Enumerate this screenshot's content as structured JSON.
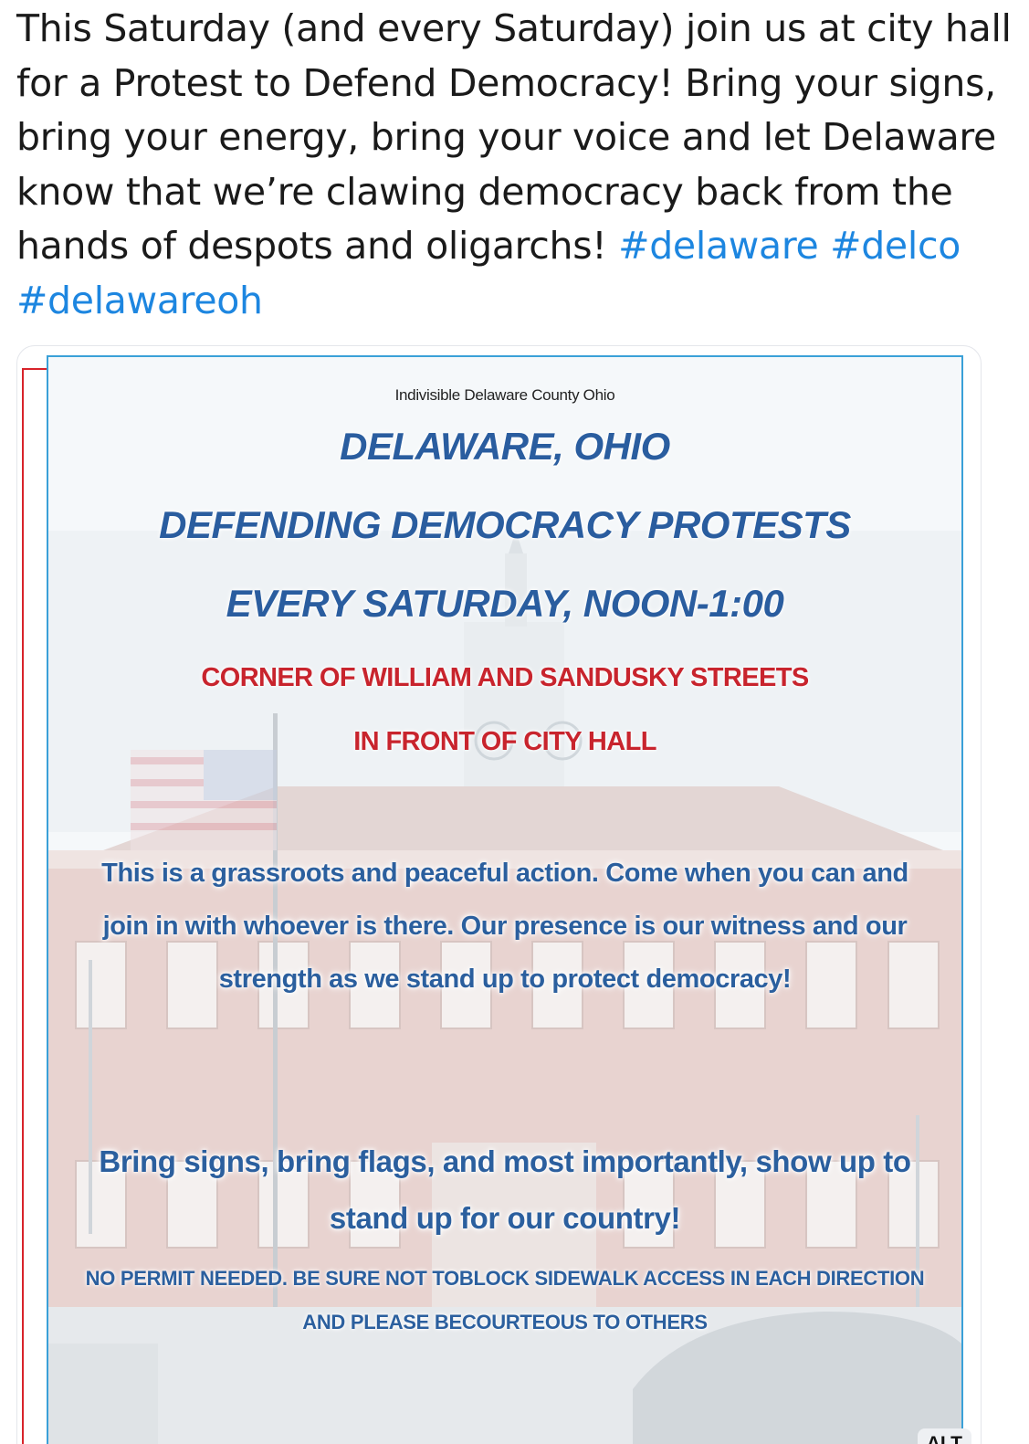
{
  "post": {
    "text_main": "This Saturday (and every Saturday) join us at city hall for a Protest to Defend Democracy! Bring your signs, bring your energy, bring your voice and let Delaware know that we’re clawing democracy back from the hands of despots and oligarchs! ",
    "hashtags": [
      "#delaware",
      "#delco",
      "#delawareoh"
    ]
  },
  "flyer": {
    "org": "Indivisible Delaware County Ohio",
    "heading1": "DELAWARE, OHIO",
    "heading2": "DEFENDING DEMOCRACY PROTESTS",
    "heading3": "EVERY SATURDAY, NOON-1:00",
    "location1": "CORNER OF WILLIAM AND SANDUSKY STREETS",
    "location2": "IN FRONT OF CITY HALL",
    "paragraph1": "This is a grassroots and peaceful action. Come when you can and join in with whoever is there. Our presence is our witness and our strength as we stand up to protect democracy!",
    "paragraph2": "Bring signs, bring flags, and most importantly, show up to stand up for our country!",
    "note": "NO PERMIT NEEDED.  BE SURE NOT TOBLOCK SIDEWALK ACCESS IN EACH DIRECTION AND PLEASE BECOURTEOUS TO OTHERS"
  },
  "media": {
    "alt_label": "ALT"
  },
  "colors": {
    "hashtag": "#1d86e0",
    "heading_blue": "#2a5d9f",
    "location_red": "#c8242d",
    "flyer_border": "#3aa0d8"
  }
}
